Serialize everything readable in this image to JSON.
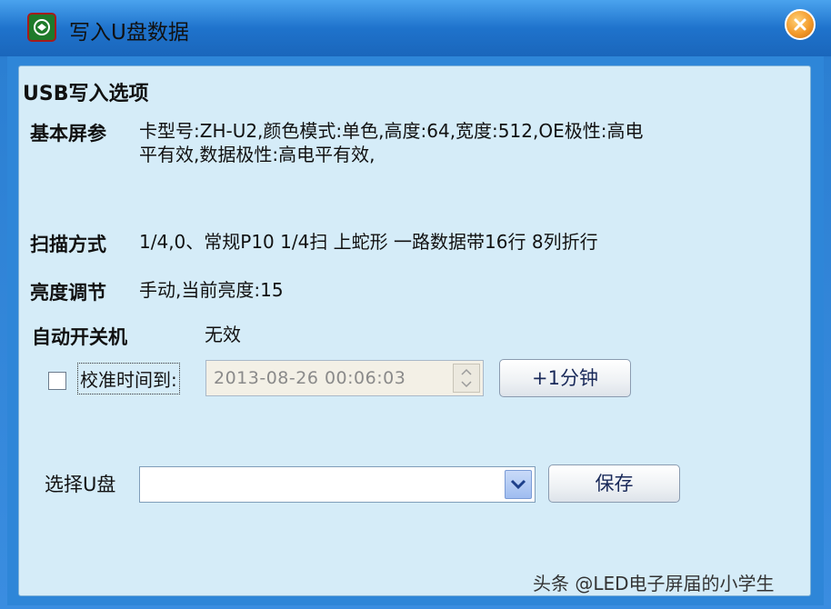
{
  "window": {
    "title": "写入U盘数据"
  },
  "group": {
    "title": "USB写入选项",
    "basic_label": "基本屏参",
    "basic_value_line1": "卡型号:ZH-U2,颜色模式:单色,高度:64,宽度:512,OE极性:高电",
    "basic_value_line2": "平有效,数据极性:高电平有效,",
    "scan_label": "扫描方式",
    "scan_value": "1/4,0、常规P10  1/4扫 上蛇形 一路数据带16行 8列折行",
    "brightness_label": "亮度调节",
    "brightness_value": "手动,当前亮度:15",
    "power_label": "自动开关机",
    "power_value": "无效",
    "calibrate_label": "校准时间到:",
    "calibrate_checked": false,
    "datetime_value": "2013-08-26   00:06:03",
    "plus_minute_label": "+1分钟",
    "udisk_label": "选择U盘",
    "udisk_selected": "",
    "save_label": "保存"
  },
  "watermark": "头条 @LED电子屏届的小学生",
  "colors": {
    "title_bar": "#1f73cc",
    "panel_bg": "#d5ecf8",
    "close_button": "#f39a2a"
  }
}
